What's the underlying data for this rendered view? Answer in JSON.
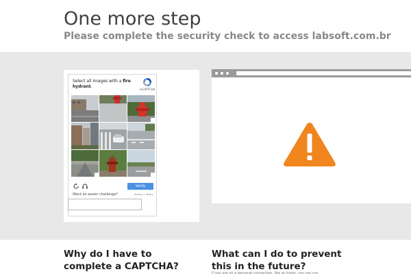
{
  "header": {
    "title": "One more step",
    "subtitle": "Please complete the security check to access labsoft.com.br"
  },
  "captcha": {
    "prompt_prefix": "Select all images with a",
    "prompt_target": "fire hydrant",
    "prompt_suffix": ".",
    "logo_text": "reCAPTCHA",
    "logo_icon": "recaptcha-icon",
    "tiles": [
      "road-street",
      "fire-hydrant-top",
      "fire-hydrant",
      "buildings",
      "crosswalk-car",
      "intersection",
      "road-trees",
      "fire-hydrant-bottom",
      "road-sky"
    ],
    "reload_icon": "reload-icon",
    "audio_icon": "headphones-icon",
    "verify_label": "Verify",
    "easier_text": "Want an easier challenge?",
    "privacy_text": "Privacy • Terms"
  },
  "browser": {
    "warning_icon": "warning-icon"
  },
  "faq": {
    "q1": "Why do I have to complete a CAPTCHA?",
    "q2": "What can I do to prevent this in the future?",
    "q2_snippet": "If you are on a personal connection, like at home, you can run"
  },
  "colors": {
    "band": "#e8e8e8",
    "warning": "#f0861d",
    "verify": "#4a90e2",
    "browser_bar": "#9a9a9a"
  }
}
